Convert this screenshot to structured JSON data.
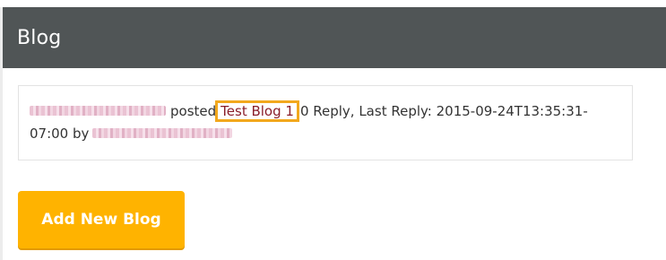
{
  "header": {
    "title": "Blog"
  },
  "post": {
    "verb": "posted",
    "blog_title": "Test Blog 1",
    "replies_text": "0 Reply, Last Reply: 2015-09-24T13:35:31-07:00 by"
  },
  "actions": {
    "add_label": "Add New Blog"
  },
  "colors": {
    "header_bg": "#505556",
    "link": "#8a1e2a",
    "highlight": "#f2a81d",
    "button_bg": "#ffb300"
  }
}
